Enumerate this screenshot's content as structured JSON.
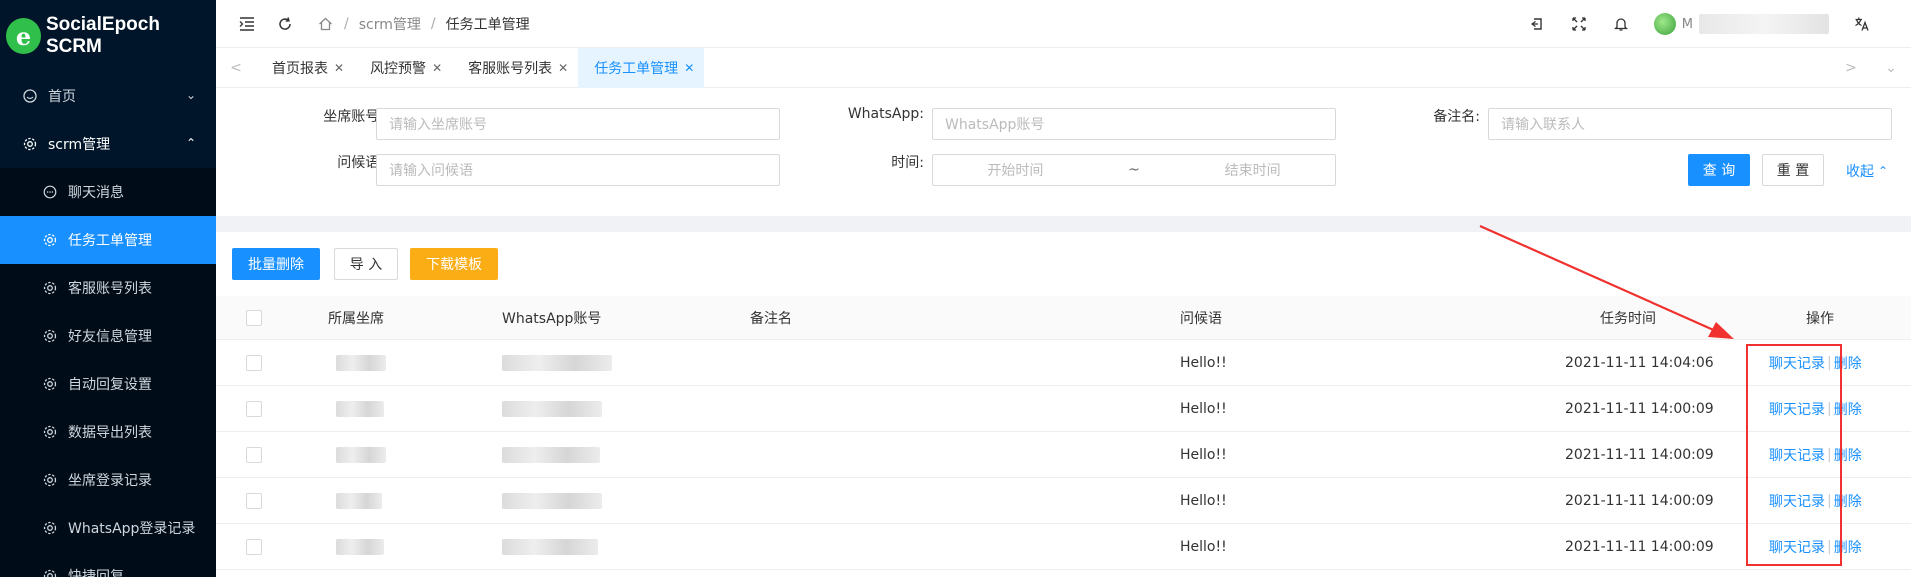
{
  "app": {
    "name": "SocialEpoch SCRM",
    "logo_letter": "e"
  },
  "sidebar": {
    "items": [
      {
        "label": "首页",
        "icon": "dashboard-icon",
        "arrow": "⌄"
      },
      {
        "label": "scrm管理",
        "icon": "gear-icon",
        "arrow": "⌃"
      }
    ],
    "submenu": [
      {
        "label": "聊天消息",
        "icon": "chat-bubble-icon"
      },
      {
        "label": "任务工单管理",
        "icon": "gear-icon"
      },
      {
        "label": "客服账号列表",
        "icon": "gear-icon"
      },
      {
        "label": "好友信息管理",
        "icon": "gear-icon"
      },
      {
        "label": "自动回复设置",
        "icon": "gear-icon"
      },
      {
        "label": "数据导出列表",
        "icon": "gear-icon"
      },
      {
        "label": "坐席登录记录",
        "icon": "gear-icon"
      },
      {
        "label": "WhatsApp登录记录",
        "icon": "gear-icon"
      },
      {
        "label": "快捷回复",
        "icon": "gear-icon"
      }
    ]
  },
  "header": {
    "breadcrumb": [
      "scrm管理",
      "任务工单管理"
    ],
    "user_initial": "M"
  },
  "tabs": [
    {
      "label": "首页报表"
    },
    {
      "label": "风控预警"
    },
    {
      "label": "客服账号列表"
    },
    {
      "label": "任务工单管理"
    }
  ],
  "form": {
    "seat_label": "坐席账号:",
    "seat_placeholder": "请输入坐席账号",
    "whatsapp_label": "WhatsApp:",
    "whatsapp_placeholder": "WhatsApp账号",
    "remark_label": "备注名:",
    "remark_placeholder": "请输入联系人",
    "greeting_label": "问候语:",
    "greeting_placeholder": "请输入问候语",
    "time_label": "时间:",
    "time_start_placeholder": "开始时间",
    "time_sep": "~",
    "time_end_placeholder": "结束时间",
    "query_label": "查 询",
    "reset_label": "重 置",
    "collapse_label": "收起"
  },
  "toolbar": {
    "batch_delete": "批量删除",
    "import": "导 入",
    "download_template": "下载模板"
  },
  "table": {
    "headers": [
      "所属坐席",
      "WhatsApp账号",
      "备注名",
      "问候语",
      "任务时间",
      "操作"
    ],
    "rows": [
      {
        "greeting": "Hello!!",
        "time": "2021-11-11 14:04:06",
        "chat": "聊天记录",
        "del": "删除"
      },
      {
        "greeting": "Hello!!",
        "time": "2021-11-11 14:00:09",
        "chat": "聊天记录",
        "del": "删除"
      },
      {
        "greeting": "Hello!!",
        "time": "2021-11-11 14:00:09",
        "chat": "聊天记录",
        "del": "删除"
      },
      {
        "greeting": "Hello!!",
        "time": "2021-11-11 14:00:09",
        "chat": "聊天记录",
        "del": "删除"
      },
      {
        "greeting": "Hello!!",
        "time": "2021-11-11 14:00:09",
        "chat": "聊天记录",
        "del": "删除"
      }
    ]
  },
  "colors": {
    "primary": "#1890ff",
    "sidebar_bg": "#001529",
    "warning": "#faad14",
    "annotation_red": "#f0312f"
  }
}
